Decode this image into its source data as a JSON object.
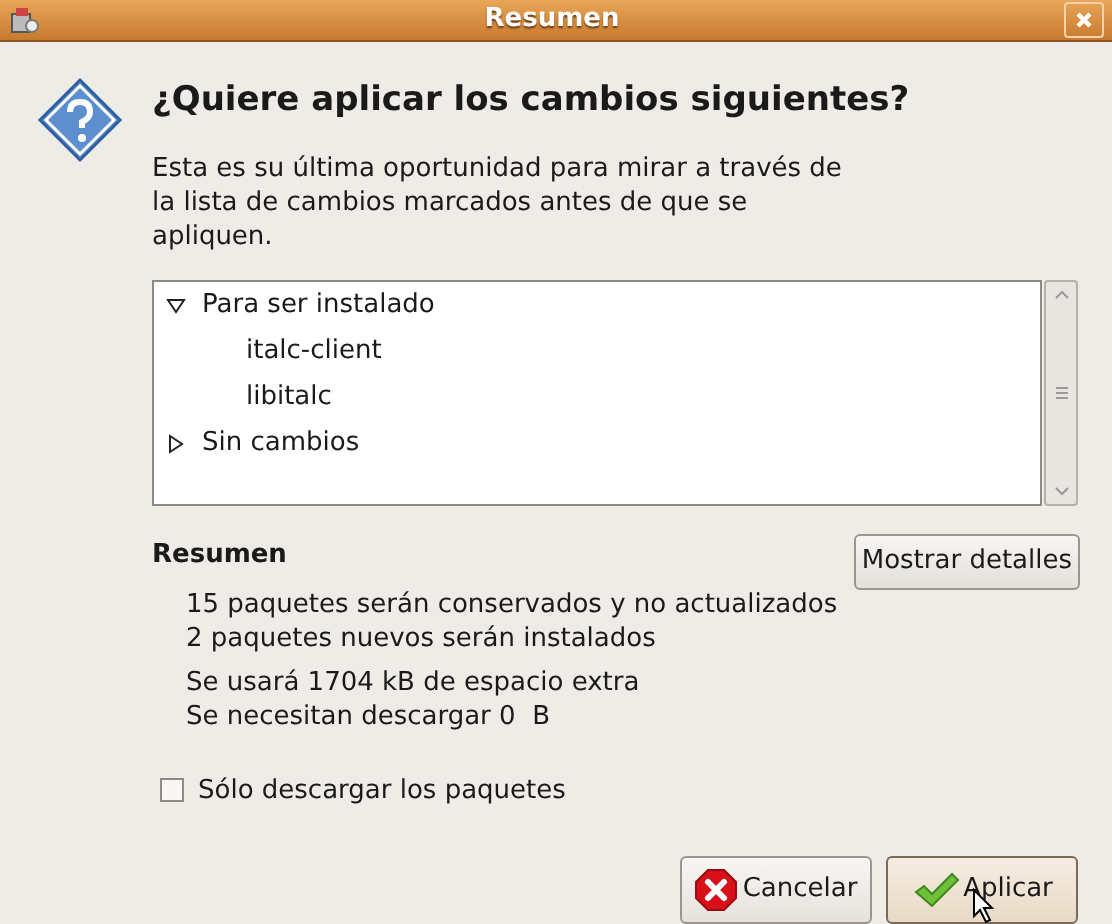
{
  "window": {
    "title": "Resumen"
  },
  "heading": "¿Quiere aplicar los cambios siguientes?",
  "description": "Esta es su última oportunidad para mirar a través de la lista de cambios marcados antes de que se apliquen.",
  "tree": [
    {
      "label": "Para ser instalado",
      "expanded": true,
      "children": [
        {
          "label": "italc-client"
        },
        {
          "label": "libitalc"
        }
      ]
    },
    {
      "label": "Sin cambios",
      "expanded": false
    }
  ],
  "summary": {
    "title": "Resumen",
    "details_button": "Mostrar detalles",
    "lines": [
      [
        "15 paquetes serán conservados y no actualizados",
        "2 paquetes nuevos serán instalados"
      ],
      [
        "Se usará 1704 kB de espacio extra",
        "Se necesitan descargar 0  B"
      ]
    ]
  },
  "download_only": {
    "label": "Sólo descargar los paquetes",
    "checked": false
  },
  "buttons": [
    {
      "kind": "cancel",
      "label": "Cancelar",
      "focused": false
    },
    {
      "kind": "apply",
      "label": "Aplicar",
      "focused": true
    }
  ]
}
